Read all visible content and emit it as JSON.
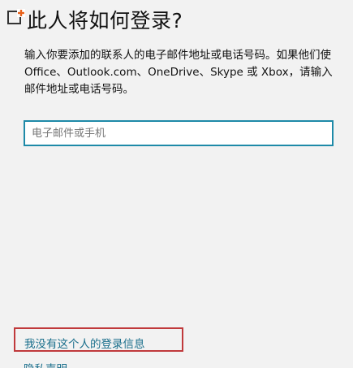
{
  "dialog": {
    "icon": "app-icon",
    "accent_color": "#e8611a",
    "title": "此人将如何登录?",
    "description_lines": [
      "输入你要添加的联系人的电子邮件地址或电话号码。如果他们使",
      "Office、Outlook.com、OneDrive、Skype 或 Xbox，请输入",
      "邮件地址或电话号码。"
    ],
    "email_input": {
      "placeholder": "电子邮件或手机",
      "value": ""
    },
    "no_info_link": "我没有这个人的登录信息",
    "privacy_link": "隐私声明"
  }
}
